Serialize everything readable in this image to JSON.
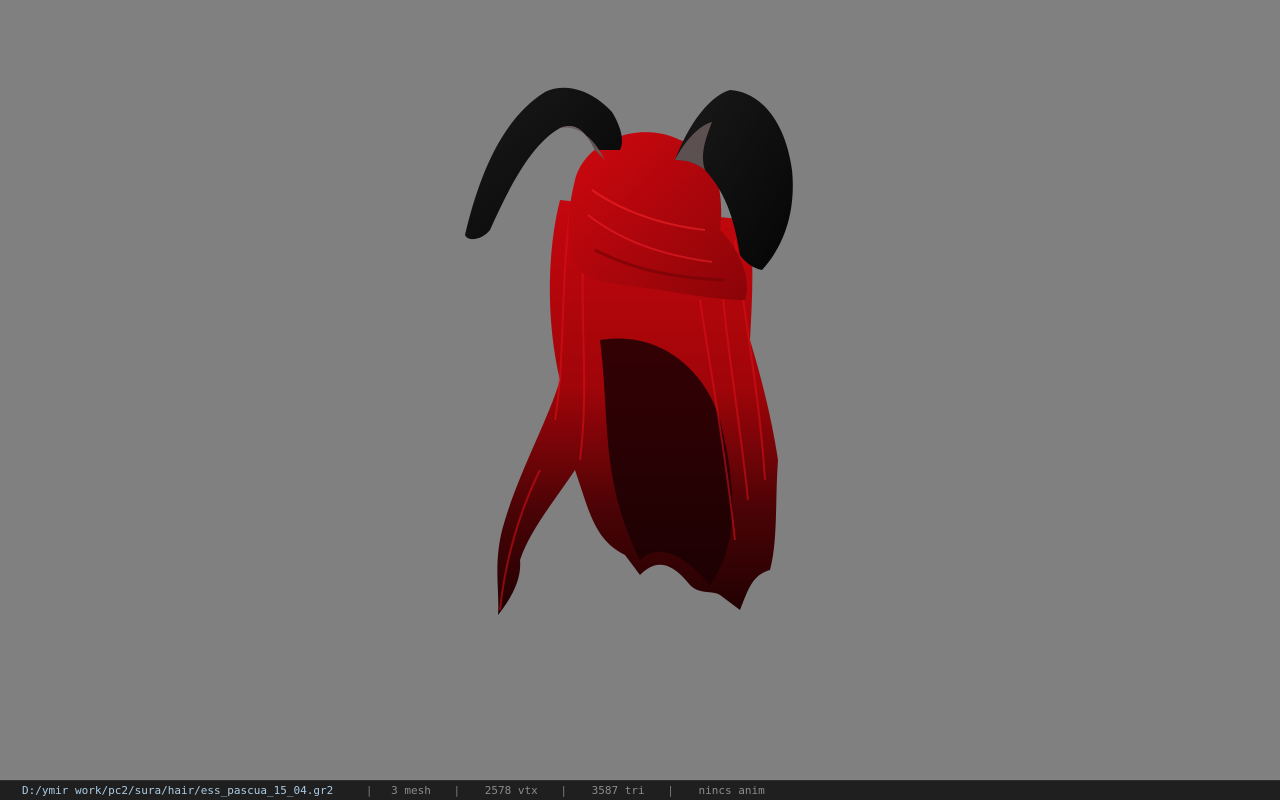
{
  "viewport": {
    "background_color": "#808080",
    "model": {
      "hair_color": "#b0060c",
      "hair_shadow_color": "#3a0204",
      "ear_color": "#0d0d0d",
      "ear_inner_color": "#6a5a5c"
    }
  },
  "statusbar": {
    "file_path": "D:/ymir work/pc2/sura/hair/ess_pascua_15_04.gr2",
    "separator": "|",
    "mesh_count": "3 mesh",
    "vertex_count": "2578 vtx",
    "triangle_count": "3587 tri",
    "anim_info": "nincs anim"
  }
}
